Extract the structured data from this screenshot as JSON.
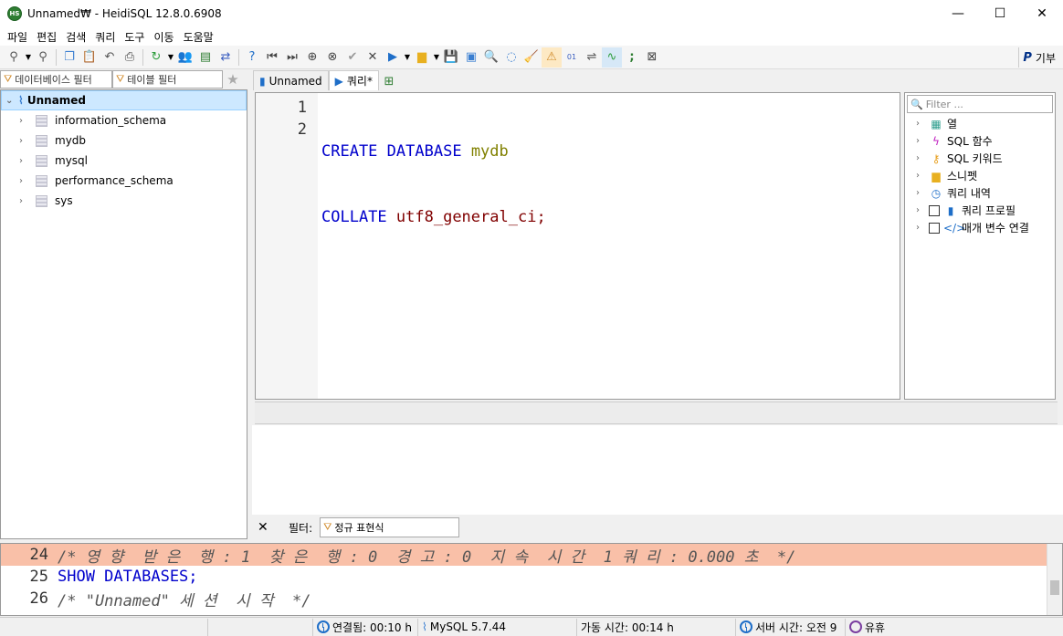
{
  "window": {
    "title": "Unnamed₩ - HeidiSQL 12.8.0.6908",
    "app_icon_label": "HS"
  },
  "menu": [
    "파일",
    "편집",
    "검색",
    "쿼리",
    "도구",
    "이동",
    "도움말"
  ],
  "toolbar": {
    "donate_label": "기부",
    "donate_icon": "P"
  },
  "left": {
    "db_filter_placeholder": "데이터베이스 필터",
    "table_filter_placeholder": "테이블 필터",
    "tree_root": "Unnamed",
    "databases": [
      "information_schema",
      "mydb",
      "mysql",
      "performance_schema",
      "sys"
    ]
  },
  "tabs": [
    {
      "label": "Unnamed"
    },
    {
      "label": "쿼리*"
    }
  ],
  "editor": {
    "line_numbers": [
      "1",
      "2"
    ],
    "line1": {
      "kw1": "CREATE",
      "kw2": "DATABASE",
      "name": "mydb"
    },
    "line2": {
      "kw1": "COLLATE",
      "collation": "utf8_general_ci",
      "term": ";"
    }
  },
  "helper": {
    "filter_placeholder": "Filter ...",
    "items": [
      "열",
      "SQL 함수",
      "SQL 키워드",
      "스니펫",
      "쿼리 내역",
      "쿼리 프로필",
      "매개 변수 연결"
    ]
  },
  "result_filter": {
    "label": "필터:",
    "placeholder": "정규 표현식"
  },
  "log": [
    {
      "num": "24",
      "text": "/* 영 향  받 은  행 : 1  찾 은  행 : 0  경 고 : 0  지 속  시 간  1 쿼 리 : 0.000 초  */"
    },
    {
      "num": "25",
      "text": "SHOW DATABASES;"
    },
    {
      "num": "26",
      "text": "/* \"Unnamed\" 세 션  시 작  */"
    }
  ],
  "status": {
    "connected": "연결됨: 00:10 h",
    "server": "MySQL 5.7.44",
    "uptime": "가동 시간: 00:14 h",
    "server_time": "서버 시간: 오전 9",
    "idle": "유휴"
  }
}
